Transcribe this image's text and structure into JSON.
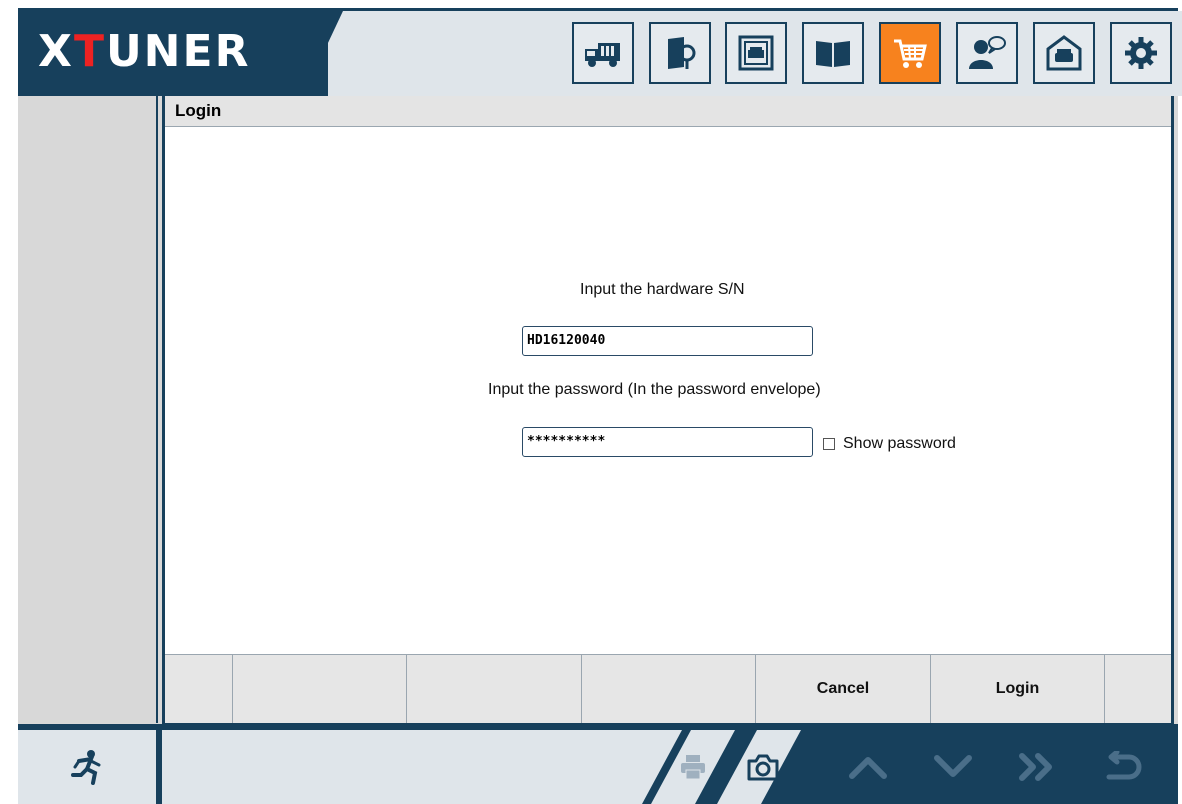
{
  "app": {
    "logo_prefix": "X",
    "logo_t": "T",
    "logo_suffix": "UNER"
  },
  "nav": {
    "items": [
      {
        "name": "truck-icon",
        "active": false
      },
      {
        "name": "search-book-icon",
        "active": false
      },
      {
        "name": "vehicle-screen-icon",
        "active": false
      },
      {
        "name": "manual-book-icon",
        "active": false
      },
      {
        "name": "cart-icon",
        "active": true
      },
      {
        "name": "user-chat-icon",
        "active": false
      },
      {
        "name": "garage-icon",
        "active": false
      },
      {
        "name": "gear-icon",
        "active": false
      }
    ]
  },
  "panel": {
    "title": "Login"
  },
  "form": {
    "sn_label": "Input the hardware S/N",
    "sn_value": "HD16120040",
    "password_label": "Input the password (In the password envelope)",
    "password_value": "**********",
    "show_password_label": "Show password"
  },
  "buttons": {
    "cancel": "Cancel",
    "login": "Login"
  },
  "bottom": {
    "exit_icon": "running-man-icon",
    "print_icon": "printer-icon",
    "camera_icon": "camera-icon",
    "up_icon": "chevron-up-icon",
    "down_icon": "chevron-down-icon",
    "next_icon": "double-chevron-right-icon",
    "back_icon": "return-icon"
  },
  "colors": {
    "dark": "#17405c",
    "accent": "#f7821e",
    "light": "#dfe5ea"
  }
}
